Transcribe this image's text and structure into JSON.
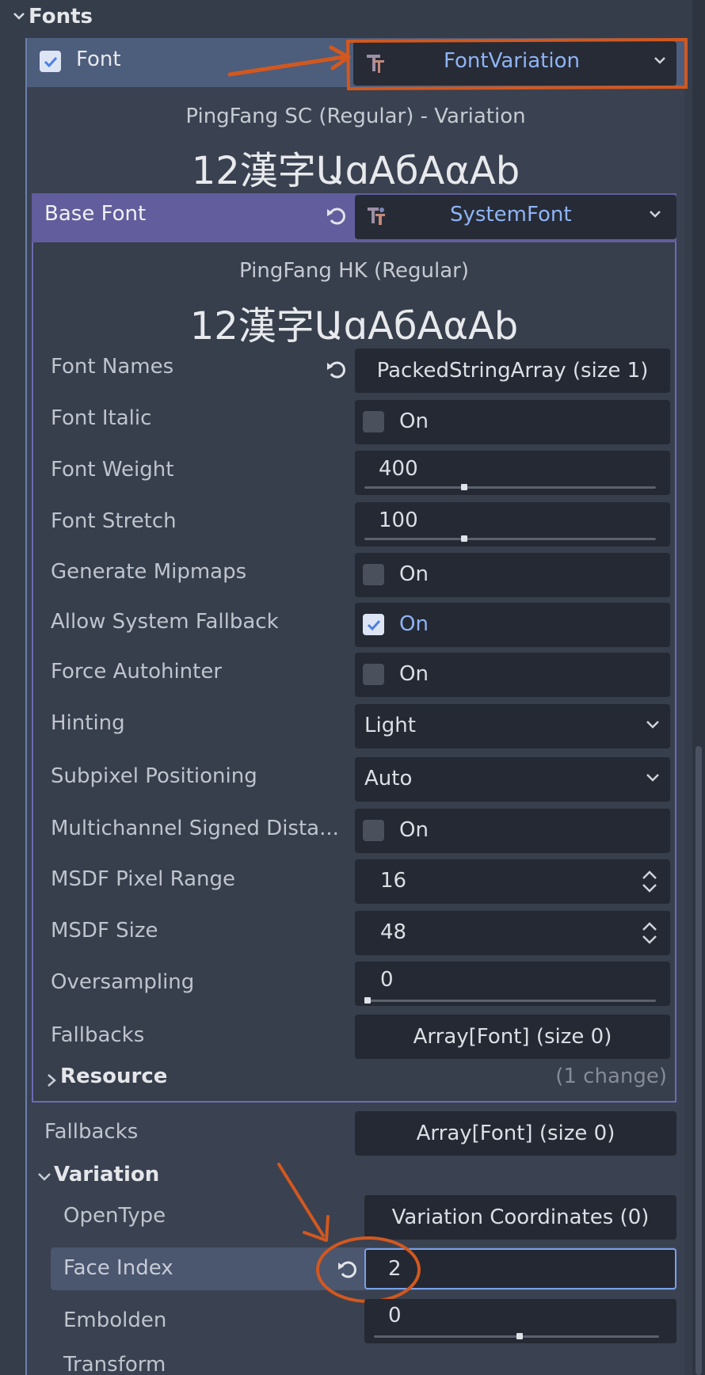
{
  "section_title": "Fonts",
  "font_property": {
    "label": "Font",
    "checked": true,
    "value": "FontVariation",
    "preview_name": "PingFang SC (Regular)  - Variation",
    "preview_sample": "12漢字ԱɑАбΑαАb"
  },
  "base_font": {
    "label": "Base Font",
    "value": "SystemFont",
    "preview_name": "PingFang HK (Regular)",
    "preview_sample": "12漢字ԱɑАбΑαАb",
    "properties": {
      "font_names": {
        "label": "Font Names",
        "value": "PackedStringArray (size 1)"
      },
      "font_italic": {
        "label": "Font Italic",
        "value": "On",
        "checked": false
      },
      "font_weight": {
        "label": "Font Weight",
        "value": "400",
        "fraction": 0.35
      },
      "font_stretch": {
        "label": "Font Stretch",
        "value": "100",
        "fraction": 0.35
      },
      "generate_mipmaps": {
        "label": "Generate Mipmaps",
        "value": "On",
        "checked": false
      },
      "allow_system_fallback": {
        "label": "Allow System Fallback",
        "value": "On",
        "checked": true
      },
      "force_autohinter": {
        "label": "Force Autohinter",
        "value": "On",
        "checked": false
      },
      "hinting": {
        "label": "Hinting",
        "value": "Light"
      },
      "subpixel_positioning": {
        "label": "Subpixel Positioning",
        "value": "Auto"
      },
      "msdf": {
        "label": "Multichannel Signed Dista...",
        "value": "On",
        "checked": false
      },
      "msdf_pixel_range": {
        "label": "MSDF Pixel Range",
        "value": "16"
      },
      "msdf_size": {
        "label": "MSDF Size",
        "value": "48"
      },
      "oversampling": {
        "label": "Oversampling",
        "value": "0",
        "fraction": 0.0
      },
      "fallbacks": {
        "label": "Fallbacks",
        "value": "Array[Font] (size 0)"
      }
    },
    "resource": {
      "label": "Resource",
      "changes": "(1 change)"
    }
  },
  "fallbacks": {
    "label": "Fallbacks",
    "value": "Array[Font] (size 0)"
  },
  "variation": {
    "label": "Variation",
    "opentype": {
      "label": "OpenType",
      "value": "Variation Coordinates (0)"
    },
    "face_index": {
      "label": "Face Index",
      "value": "2"
    },
    "embolden": {
      "label": "Embolden",
      "value": "0",
      "fraction": 0.5
    },
    "transform": {
      "label": "Transform"
    }
  },
  "colors": {
    "accent": "#8fb4f5",
    "annotation": "#d2581f",
    "base_font_header": "#625d9c",
    "font_row": "#4d5d7c"
  },
  "icons": {
    "font_variation": "font-variation-icon",
    "system_font": "system-font-icon",
    "reset": "reset-icon",
    "dropdown": "chevron-down-icon",
    "spinner": "spinner-arrows-icon"
  }
}
